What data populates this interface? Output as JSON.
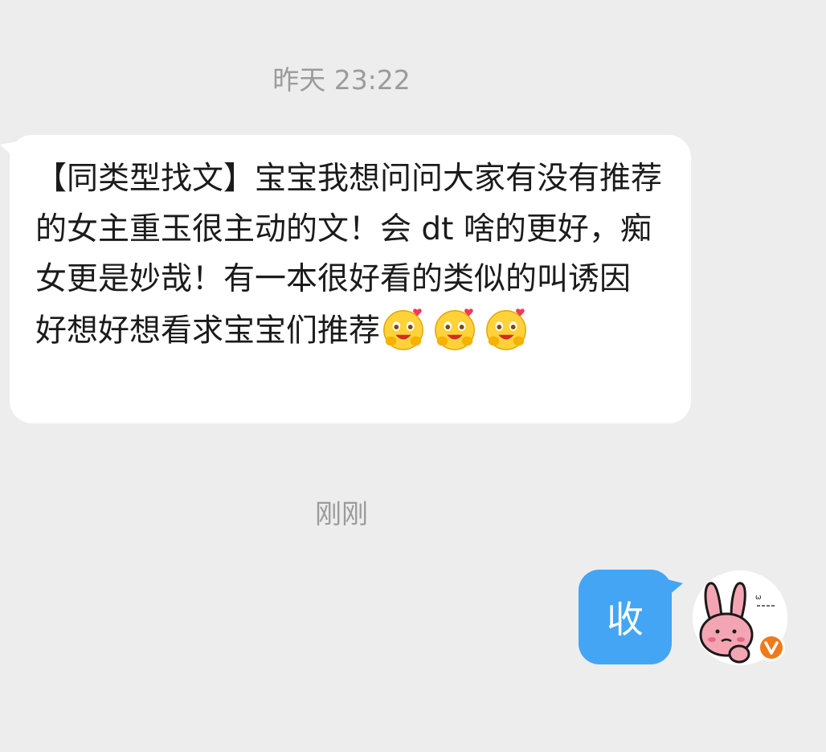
{
  "timestamps": {
    "first": "昨天 23:22",
    "second": "刚刚"
  },
  "incoming_message": {
    "text": "【同类型找文】宝宝我想问问大家有没有推荐的女主重玉很主动的文！会 dt 啥的更好，痴女更是妙哉！有一本很好看的类似的叫诱因　　　好想好想看求宝宝们推荐",
    "emoji_names": [
      "hug-hearts-emoji",
      "hug-hearts-emoji",
      "hug-hearts-emoji"
    ]
  },
  "outgoing_message": {
    "text": "收"
  },
  "avatar": {
    "icon": "pink-bunny-avatar",
    "badge": "V",
    "badge_color": "#f07a1a"
  },
  "colors": {
    "background": "#ededed",
    "incoming_bubble": "#ffffff",
    "outgoing_bubble": "#44a5f4"
  }
}
